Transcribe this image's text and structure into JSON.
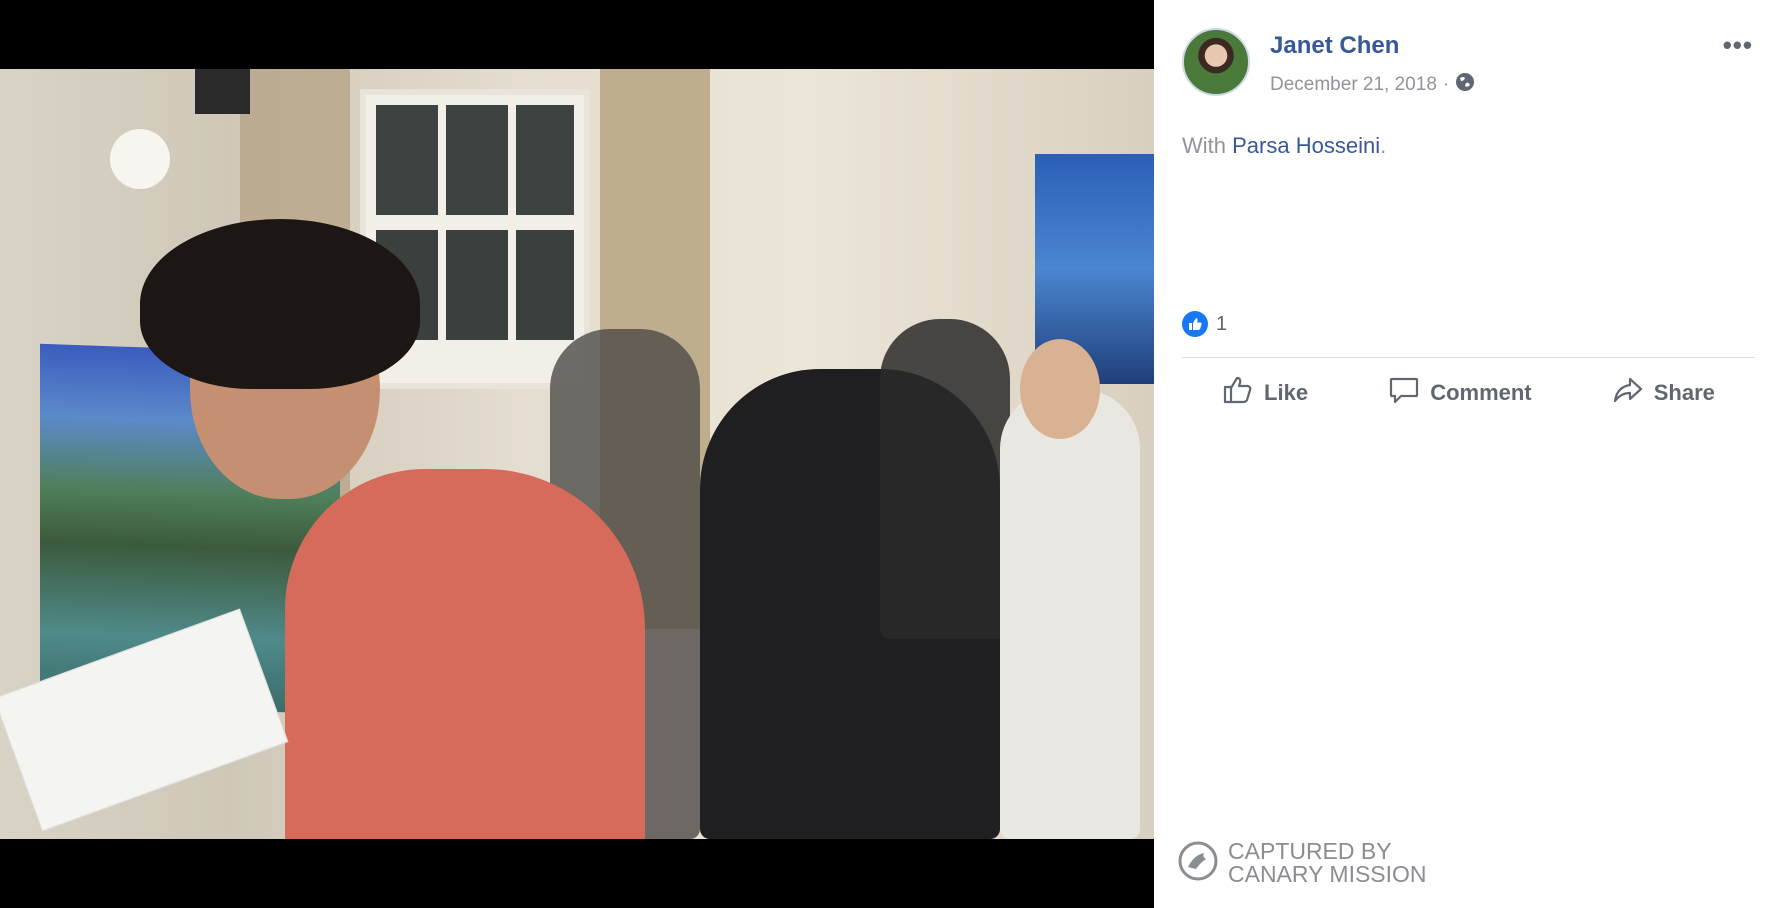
{
  "post": {
    "author": "Janet Chen",
    "date": "December 21, 2018",
    "separator": "·",
    "audience_icon": "globe-icon",
    "more_label": "•••",
    "caption_prefix": "With",
    "tagged_person": "Parsa Hosseini",
    "caption_suffix": ".",
    "reaction_count": "1"
  },
  "actions": {
    "like": "Like",
    "comment": "Comment",
    "share": "Share"
  },
  "watermark": {
    "line1": "CAPTURED BY",
    "line2": "CANARY MISSION"
  },
  "colors": {
    "link": "#385898",
    "muted": "#90949c",
    "like_blue": "#1877f2"
  }
}
